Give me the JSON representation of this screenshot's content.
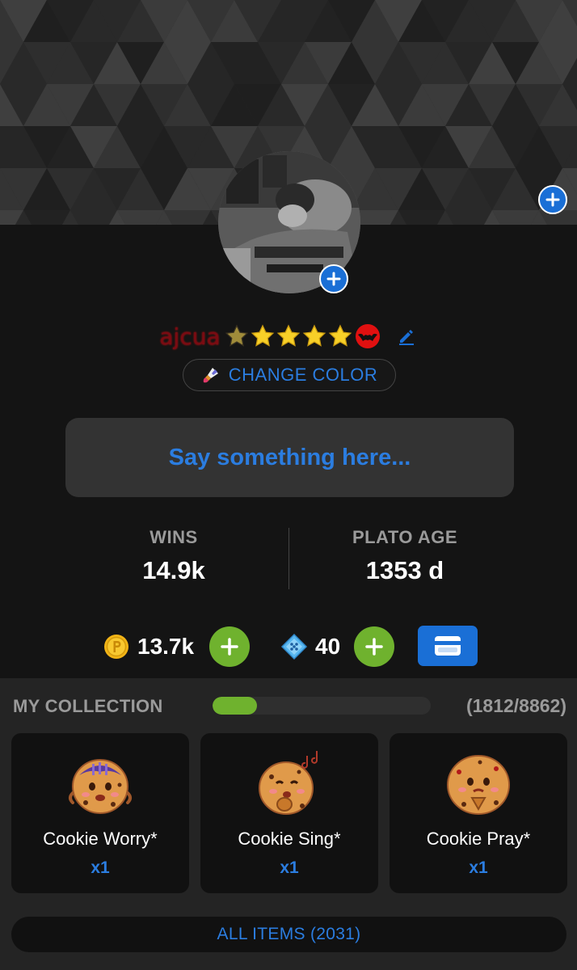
{
  "profile": {
    "username": "ajcua",
    "stars_count": 5,
    "change_color_label": "CHANGE COLOR",
    "status_placeholder": "Say something here..."
  },
  "stats": {
    "wins_label": "WINS",
    "wins_value": "14.9k",
    "age_label": "PLATO AGE",
    "age_value": "1353 d"
  },
  "currency": {
    "coins": "13.7k",
    "gems": "40"
  },
  "collection": {
    "title": "MY COLLECTION",
    "count_text": "(1812/8862)",
    "progress_fraction": 0.2045,
    "items": [
      {
        "name": "Cookie Worry*",
        "qty": "x1",
        "icon": "cookie-worry-icon"
      },
      {
        "name": "Cookie Sing*",
        "qty": "x1",
        "icon": "cookie-sing-icon"
      },
      {
        "name": "Cookie Pray*",
        "qty": "x1",
        "icon": "cookie-pray-icon"
      }
    ],
    "all_items_label": "ALL ITEMS (2031)"
  },
  "colors": {
    "accent_blue": "#1a6fd6",
    "link_blue": "#2b7de0",
    "green": "#6fb22e",
    "username_red": "#7a0b12"
  }
}
